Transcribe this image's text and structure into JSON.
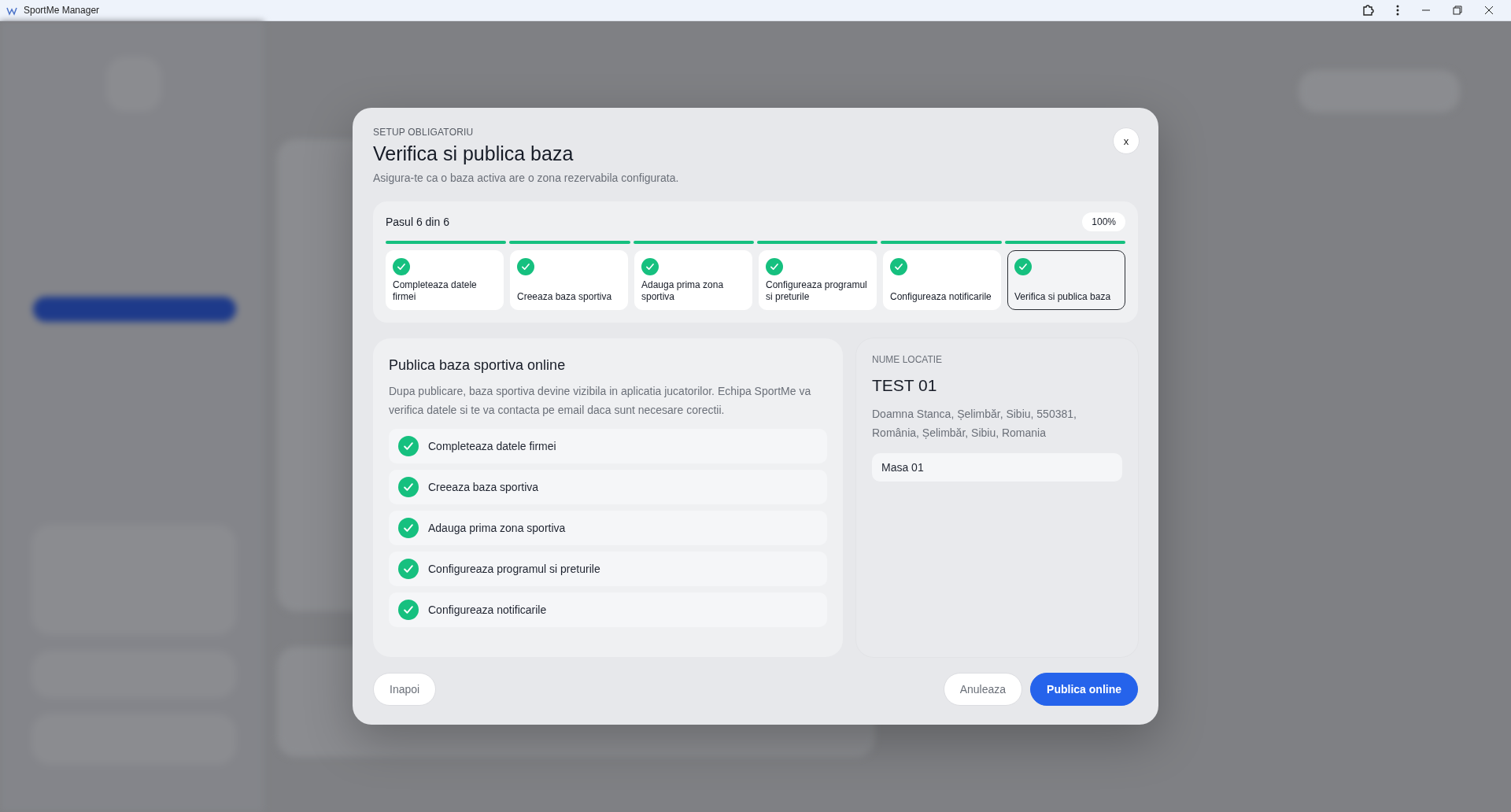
{
  "window": {
    "title": "SportMe Manager"
  },
  "modal": {
    "eyebrow": "SETUP OBLIGATORIU",
    "title": "Verifica si publica baza",
    "subtitle": "Asigura-te ca o baza activa are o zona rezervabila configurata.",
    "close": "x",
    "progress": {
      "label": "Pasul 6 din 6",
      "percent": "100%",
      "steps": [
        {
          "label": "Completeaza datele firmei",
          "done": true,
          "selected": false
        },
        {
          "label": "Creeaza baza sportiva",
          "done": true,
          "selected": false
        },
        {
          "label": "Adauga prima zona sportiva",
          "done": true,
          "selected": false
        },
        {
          "label": "Configureaza programul si preturile",
          "done": true,
          "selected": false
        },
        {
          "label": "Configureaza notificarile",
          "done": true,
          "selected": false
        },
        {
          "label": "Verifica si publica baza",
          "done": true,
          "selected": true
        }
      ]
    },
    "publish": {
      "title": "Publica baza sportiva online",
      "description": "Dupa publicare, baza sportiva devine vizibila in aplicatia jucatorilor. Echipa SportMe va verifica datele si te va contacta pe email daca sunt necesare corectii.",
      "checklist": [
        {
          "label": "Completeaza datele firmei",
          "done": true
        },
        {
          "label": "Creeaza baza sportiva",
          "done": true
        },
        {
          "label": "Adauga prima zona sportiva",
          "done": true
        },
        {
          "label": "Configureaza programul si preturile",
          "done": true
        },
        {
          "label": "Configureaza notificarile",
          "done": true
        }
      ]
    },
    "location": {
      "label": "NUME LOCATIE",
      "name": "TEST 01",
      "address": "Doamna Stanca, Șelimbăr, Sibiu, 550381, România, Șelimbăr, Sibiu, Romania",
      "zones": [
        "Masa 01"
      ]
    },
    "buttons": {
      "back": "Inapoi",
      "cancel": "Anuleaza",
      "primary": "Publica online"
    }
  }
}
